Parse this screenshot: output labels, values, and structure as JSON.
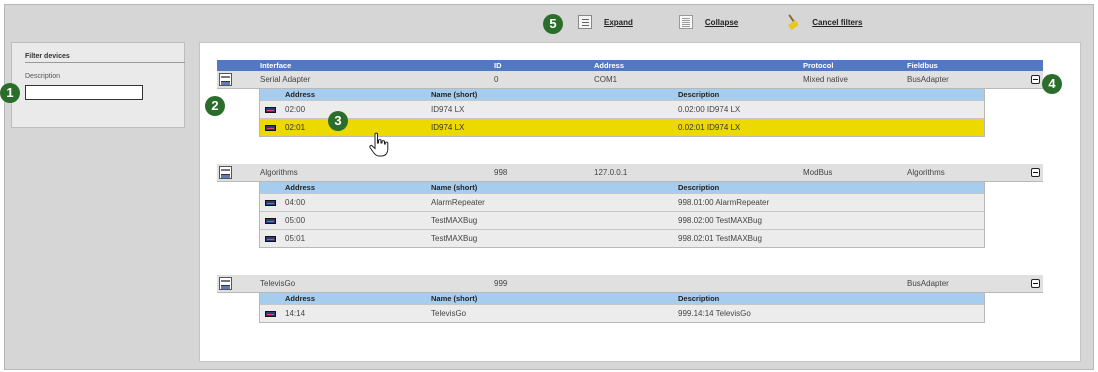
{
  "toolbar": {
    "expand_label": "Expand",
    "collapse_label": "Collapse",
    "cancel_filters_label": "Cancel filters"
  },
  "filter": {
    "title": "Filter devices",
    "description_label": "Description",
    "description_value": ""
  },
  "table": {
    "headers": {
      "interface": "Interface",
      "id": "ID",
      "address": "Address",
      "protocol": "Protocol",
      "fieldbus": "Fieldbus"
    },
    "sub_headers": {
      "address": "Address",
      "name": "Name (short)",
      "description": "Description"
    },
    "groups": [
      {
        "interface": "Serial Adapter",
        "id": "0",
        "address": "COM1",
        "protocol": "Mixed native",
        "fieldbus": "BusAdapter",
        "devices": [
          {
            "address": "02:00",
            "name": "ID974 LX",
            "description": "0.02:00 ID974 LX",
            "selected": false
          },
          {
            "address": "02:01",
            "name": "ID974 LX",
            "description": "0.02:01 ID974 LX",
            "selected": true
          }
        ]
      },
      {
        "interface": "Algorithms",
        "id": "998",
        "address": "127.0.0.1",
        "protocol": "ModBus",
        "fieldbus": "Algorithms",
        "devices": [
          {
            "address": "04:00",
            "name": "AlarmRepeater",
            "description": "998.01:00 AlarmRepeater",
            "selected": false
          },
          {
            "address": "05:00",
            "name": "TestMAXBug",
            "description": "998.02:00 TestMAXBug",
            "selected": false
          },
          {
            "address": "05:01",
            "name": "TestMAXBug",
            "description": "998.02:01 TestMAXBug",
            "selected": false
          }
        ]
      },
      {
        "interface": "TelevisGo",
        "id": "999",
        "address": "",
        "protocol": "",
        "fieldbus": "BusAdapter",
        "devices": [
          {
            "address": "14:14",
            "name": "TelevisGo",
            "description": "999.14:14 TelevisGo",
            "selected": false
          }
        ]
      }
    ]
  },
  "callouts": [
    "1",
    "2",
    "3",
    "4",
    "5"
  ],
  "colors": {
    "header_blue": "#5279c0",
    "subheader_blue": "#a6cdee",
    "selected_row": "#ecd900",
    "callout_green": "#2b6e2b"
  }
}
